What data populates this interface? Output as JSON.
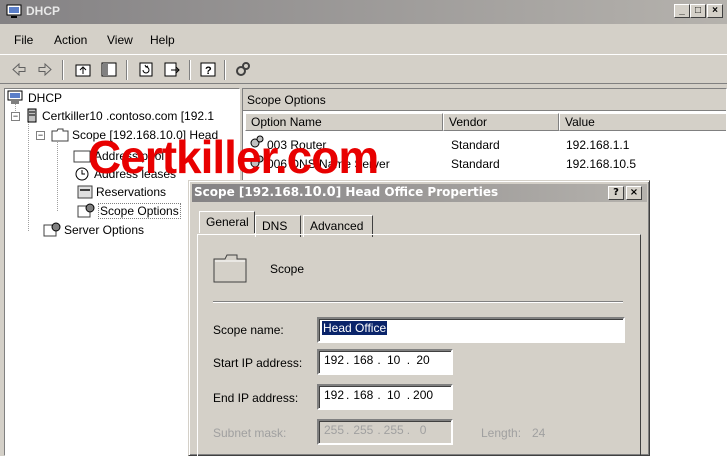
{
  "window": {
    "title": "DHCP",
    "minimize": "_",
    "restore": "□",
    "close": "×"
  },
  "menu": {
    "file": "File",
    "action": "Action",
    "view": "View",
    "help": "Help"
  },
  "toolbar_icons": [
    "back-icon",
    "forward-icon",
    "up-folder-icon",
    "show-tree-icon",
    "refresh-icon",
    "export-icon",
    "help-icon",
    "tools-icon"
  ],
  "tree": {
    "root": "DHCP",
    "server": "Certkiller10 .contoso.com [192.1",
    "scope": "Scope [192.168.10.0] Head",
    "address_pool": "Address pool",
    "address_leases": "Address leases",
    "reservations": "Reservations",
    "scope_options": "Scope Options",
    "server_options": "Server Options"
  },
  "rightpane": {
    "title": "Scope Options",
    "columns": [
      "Option Name",
      "Vendor",
      "Value"
    ],
    "rows": [
      {
        "name": "003 Router",
        "vendor": "Standard",
        "value": "192.168.1.1"
      },
      {
        "name": "006 DNS Name Server",
        "vendor": "Standard",
        "value": "192.168.10.5"
      }
    ]
  },
  "watermark": "Certkiller.com",
  "dialog": {
    "title_prefix": "Scope [192.168.",
    "title_mid": "10.0",
    "title_suffix": "] Head Office Properties",
    "help_btn": "?",
    "close_btn": "×",
    "tabs": [
      "General",
      "DNS",
      "Advanced"
    ],
    "header_label": "Scope",
    "scope_name_label": "Scope name:",
    "scope_name_value": "Head Office",
    "start_ip_label": "Start IP address:",
    "start_ip": [
      "192",
      "168",
      "10",
      "20"
    ],
    "end_ip_label": "End IP address:",
    "end_ip": [
      "192",
      "168",
      "10",
      "200"
    ],
    "subnet_label": "Subnet mask:",
    "subnet": [
      "255",
      "255",
      "255",
      "0"
    ],
    "length_label": "Length:",
    "length_value": "24"
  }
}
